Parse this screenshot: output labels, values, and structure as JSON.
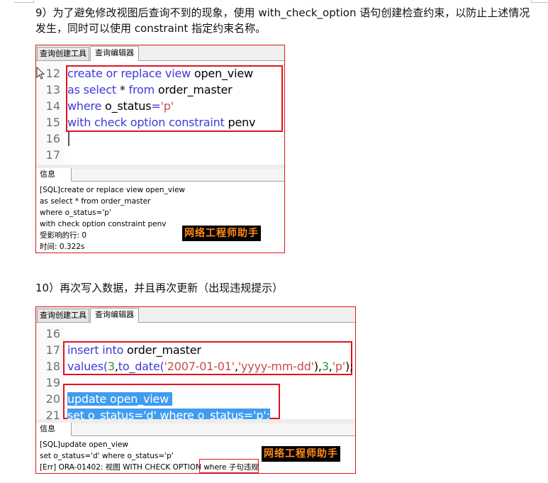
{
  "document": {
    "paragraph_9": "9）为了避免修改视图后查询不到的现象，使用 with_check_option 语句创建检查约束，以防止上述情况发生，同时可以使用 constraint 指定约束名称。",
    "paragraph_10": "10）再次写入数据，并且再次更新（出现违规提示）"
  },
  "screenshot1": {
    "tabs": [
      {
        "label": "查询创建工具",
        "active": false
      },
      {
        "label": "查询编辑器",
        "active": true
      }
    ],
    "lines": [
      {
        "n": "12",
        "tokens": [
          [
            "kw",
            "create or replace view "
          ],
          [
            "id",
            "open_view"
          ]
        ]
      },
      {
        "n": "13",
        "tokens": [
          [
            "kw",
            "as select "
          ],
          [
            "id",
            "* "
          ],
          [
            "kw",
            "from "
          ],
          [
            "id",
            "order_master"
          ]
        ]
      },
      {
        "n": "14",
        "tokens": [
          [
            "kw",
            "where "
          ],
          [
            "id",
            "o_status"
          ],
          [
            "kw",
            "="
          ],
          [
            "str",
            "'p'"
          ]
        ]
      },
      {
        "n": "15",
        "tokens": [
          [
            "kw",
            "with check option constraint "
          ],
          [
            "id",
            "penv"
          ]
        ]
      },
      {
        "n": "16",
        "tokens": []
      },
      {
        "n": "17",
        "tokens": []
      }
    ],
    "info_tab": "信息",
    "info_lines": [
      "[SQL]create or replace view open_view",
      "as select * from order_master",
      "where o_status='p'",
      "with check option constraint penv",
      "受影响的行: 0",
      "时间: 0.322s"
    ],
    "watermark": "网络工程师助手"
  },
  "screenshot2": {
    "tabs": [
      {
        "label": "查询创建工具",
        "active": false
      },
      {
        "label": "查询编辑器",
        "active": true
      }
    ],
    "lines": [
      {
        "n": "16",
        "tokens": []
      },
      {
        "n": "17",
        "tokens": [
          [
            "kw",
            "insert into "
          ],
          [
            "id",
            "order_master"
          ]
        ]
      },
      {
        "n": "18",
        "tokens": [
          [
            "kw",
            "values("
          ],
          [
            "num",
            "3"
          ],
          [
            "id",
            ","
          ],
          [
            "kw",
            "to_date("
          ],
          [
            "str",
            "'2007-01-01'"
          ],
          [
            "id",
            ","
          ],
          [
            "str",
            "'yyyy-mm-dd'"
          ],
          [
            "id",
            "),"
          ],
          [
            "num",
            "3"
          ],
          [
            "id",
            ","
          ],
          [
            "str",
            "'p'"
          ],
          [
            "id",
            ");"
          ]
        ]
      },
      {
        "n": "19",
        "tokens": []
      },
      {
        "n": "20",
        "tokens": [
          [
            "sel",
            "update open_view "
          ]
        ]
      },
      {
        "n": "21",
        "tokens": [
          [
            "sel",
            "set o_status='d' where o_status='p';"
          ]
        ]
      }
    ],
    "info_tab": "信息",
    "info_lines": [
      "[SQL]update open_view",
      "set o_status='d' where o_status='p'",
      "[Err] ORA-01402: 视图 WITH CHECK OPTION where 子句违规"
    ],
    "watermark": "网络工程师助手"
  },
  "colors": {
    "highlight_border": "#e0141e",
    "keyword": "#3b3bd8",
    "string": "#c84c4c",
    "number": "#2c9a2c",
    "selection": "#3f9cf0",
    "watermark_text": "#ff8a1c"
  }
}
